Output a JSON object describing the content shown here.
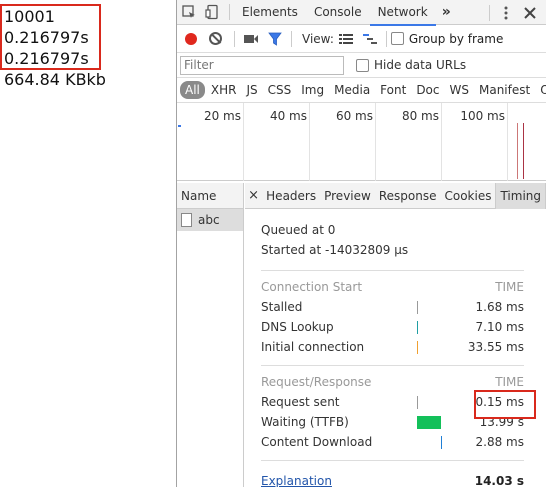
{
  "output": {
    "lines": [
      "10001",
      "0.216797s",
      "0.216797s",
      "664.84 KBkb"
    ]
  },
  "devtools": {
    "tabs": [
      "Elements",
      "Console",
      "Network"
    ],
    "active_tab": "Network",
    "more_label": "»",
    "toolbar": {
      "view_label": "View:",
      "group_by_frame": "Group by frame"
    },
    "filter": {
      "placeholder": "Filter",
      "hide_data_urls": "Hide data URLs"
    },
    "types": [
      "All",
      "XHR",
      "JS",
      "CSS",
      "Img",
      "Media",
      "Font",
      "Doc",
      "WS",
      "Manifest",
      "Oth"
    ],
    "active_type": "All",
    "overview_ticks": [
      "20 ms",
      "40 ms",
      "60 ms",
      "80 ms",
      "100 ms"
    ],
    "name_column": {
      "header": "Name",
      "rows": [
        "abc"
      ]
    },
    "detail_tabs": [
      "Headers",
      "Preview",
      "Response",
      "Cookies",
      "Timing"
    ],
    "active_detail_tab": "Timing",
    "timing": {
      "queued": "Queued at 0",
      "started": "Started at -14032809 µs",
      "sections": [
        {
          "title": "Connection Start",
          "time_label": "TIME",
          "rows": [
            {
              "label": "Stalled",
              "value": "1.68 ms",
              "color": "#9a9a9a"
            },
            {
              "label": "DNS Lookup",
              "value": "7.10 ms",
              "color": "#1f9ea3"
            },
            {
              "label": "Initial connection",
              "value": "33.55 ms",
              "color": "#f0a030"
            }
          ]
        },
        {
          "title": "Request/Response",
          "time_label": "TIME",
          "rows": [
            {
              "label": "Request sent",
              "value": "0.15 ms",
              "color": "#9a9a9a"
            },
            {
              "label": "Waiting (TTFB)",
              "value": "13.99 s",
              "color": "#13c05a"
            },
            {
              "label": "Content Download",
              "value": "2.88 ms",
              "color": "#1f7fd6"
            }
          ]
        }
      ],
      "explanation": "Explanation",
      "total": "14.03 s"
    }
  },
  "colors": {
    "highlight_red": "#d9291c",
    "accent_blue": "#3b78e7",
    "record_red": "#e0281e"
  }
}
